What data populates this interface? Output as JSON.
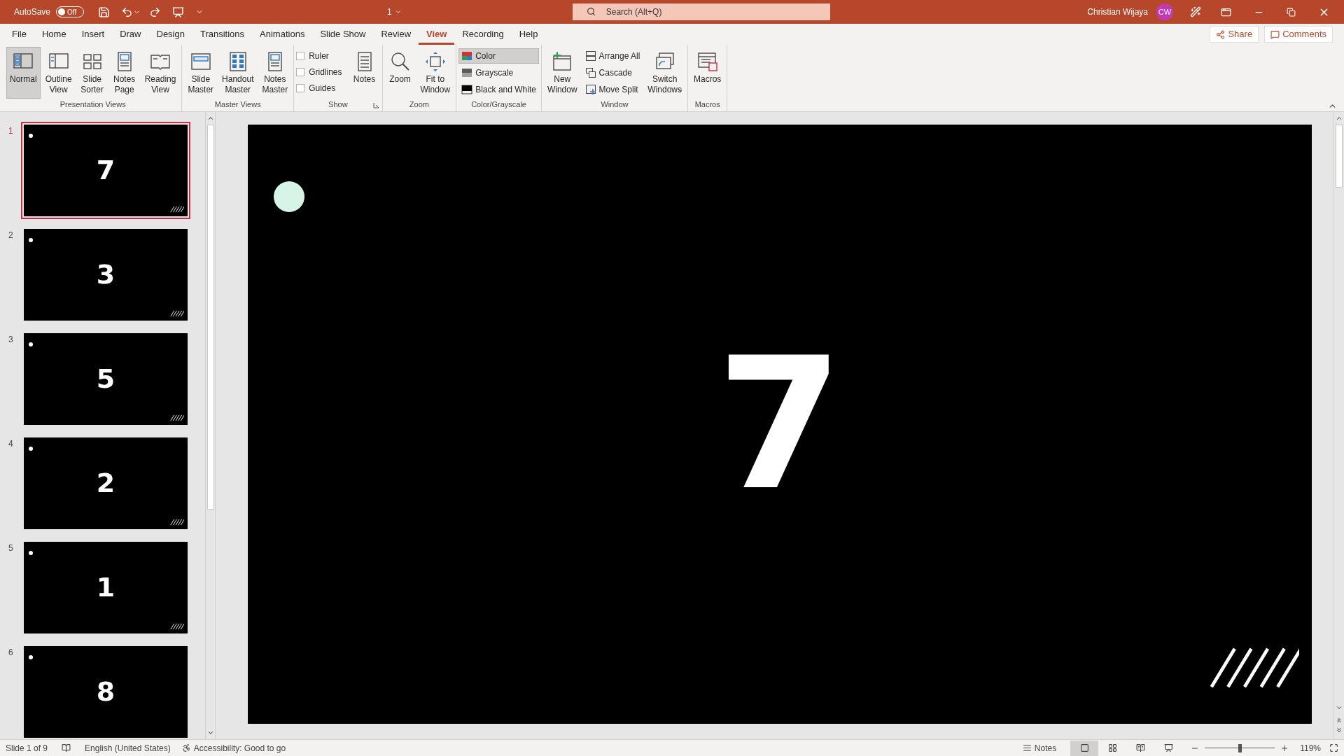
{
  "title_bar": {
    "autosave_label": "AutoSave",
    "autosave": {
      "on": false,
      "label": "Off"
    },
    "file_name": "1",
    "search": {
      "placeholder": "Search (Alt+Q)"
    },
    "user_name": "Christian Wijaya",
    "avatar_initials": "CW"
  },
  "menu_tabs": [
    {
      "label": "File",
      "selected": false
    },
    {
      "label": "Home",
      "selected": false
    },
    {
      "label": "Insert",
      "selected": false
    },
    {
      "label": "Draw",
      "selected": false
    },
    {
      "label": "Design",
      "selected": false
    },
    {
      "label": "Transitions",
      "selected": false
    },
    {
      "label": "Animations",
      "selected": false
    },
    {
      "label": "Slide Show",
      "selected": false
    },
    {
      "label": "Review",
      "selected": false
    },
    {
      "label": "View",
      "selected": true
    },
    {
      "label": "Recording",
      "selected": false
    },
    {
      "label": "Help",
      "selected": false
    }
  ],
  "share_button": "Share",
  "comments_button": "Comments",
  "ribbon_groups": [
    {
      "title": "Presentation Views",
      "items": [
        {
          "kind": "large",
          "label": "Normal",
          "selected": true
        },
        {
          "kind": "large",
          "label": "Outline\nView",
          "selected": false
        },
        {
          "kind": "large",
          "label": "Slide\nSorter",
          "selected": false
        },
        {
          "kind": "large",
          "label": "Notes\nPage",
          "selected": false
        },
        {
          "kind": "large",
          "label": "Reading\nView",
          "selected": false
        }
      ]
    },
    {
      "title": "Master Views",
      "items": [
        {
          "kind": "large",
          "label": "Slide\nMaster",
          "selected": false
        },
        {
          "kind": "large",
          "label": "Handout\nMaster",
          "selected": false
        },
        {
          "kind": "large",
          "label": "Notes\nMaster",
          "selected": false
        }
      ]
    },
    {
      "title": "Show",
      "launcher": true,
      "items": [
        {
          "kind": "checks",
          "checks": [
            {
              "label": "Ruler",
              "checked": false
            },
            {
              "label": "Gridlines",
              "checked": false
            },
            {
              "label": "Guides",
              "checked": false
            }
          ]
        },
        {
          "kind": "large",
          "label": "Notes",
          "selected": false
        }
      ]
    },
    {
      "title": "Zoom",
      "items": [
        {
          "kind": "large",
          "label": "Zoom",
          "selected": false
        },
        {
          "kind": "large",
          "label": "Fit to\nWindow",
          "selected": false
        }
      ]
    },
    {
      "title": "Color/Grayscale",
      "items": [
        {
          "kind": "small",
          "buttons": [
            {
              "label": "Color",
              "selected": true
            },
            {
              "label": "Grayscale",
              "selected": false
            },
            {
              "label": "Black and White",
              "selected": false
            }
          ]
        }
      ]
    },
    {
      "title": "Window",
      "items": [
        {
          "kind": "large",
          "label": "New\nWindow",
          "selected": false
        },
        {
          "kind": "small",
          "buttons": [
            {
              "label": "Arrange All",
              "selected": false
            },
            {
              "label": "Cascade",
              "selected": false
            },
            {
              "label": "Move Split",
              "selected": false
            }
          ]
        },
        {
          "kind": "large",
          "label": "Switch\nWindows",
          "dropdown": true,
          "selected": false
        }
      ]
    },
    {
      "title": "Macros",
      "items": [
        {
          "kind": "large",
          "label": "Macros",
          "selected": false
        }
      ]
    }
  ],
  "slides": [
    {
      "number": "1",
      "digit": "7",
      "selected": true
    },
    {
      "number": "2",
      "digit": "3",
      "selected": false
    },
    {
      "number": "3",
      "digit": "5",
      "selected": false
    },
    {
      "number": "4",
      "digit": "2",
      "selected": false
    },
    {
      "number": "5",
      "digit": "1",
      "selected": false
    },
    {
      "number": "6",
      "digit": "8",
      "selected": false
    }
  ],
  "current_slide": {
    "digit": "7"
  },
  "status_bar": {
    "slide_info": "Slide 1 of 9",
    "language": "English (United States)",
    "accessibility": "Accessibility: Good to go",
    "notes_button": "Notes",
    "views": [
      {
        "kind": "normal",
        "selected": true
      },
      {
        "kind": "sorter",
        "selected": false
      },
      {
        "kind": "reading",
        "selected": false
      },
      {
        "kind": "slideshow",
        "selected": false
      }
    ],
    "zoom": {
      "level": 0.5,
      "reading": "119%"
    }
  }
}
